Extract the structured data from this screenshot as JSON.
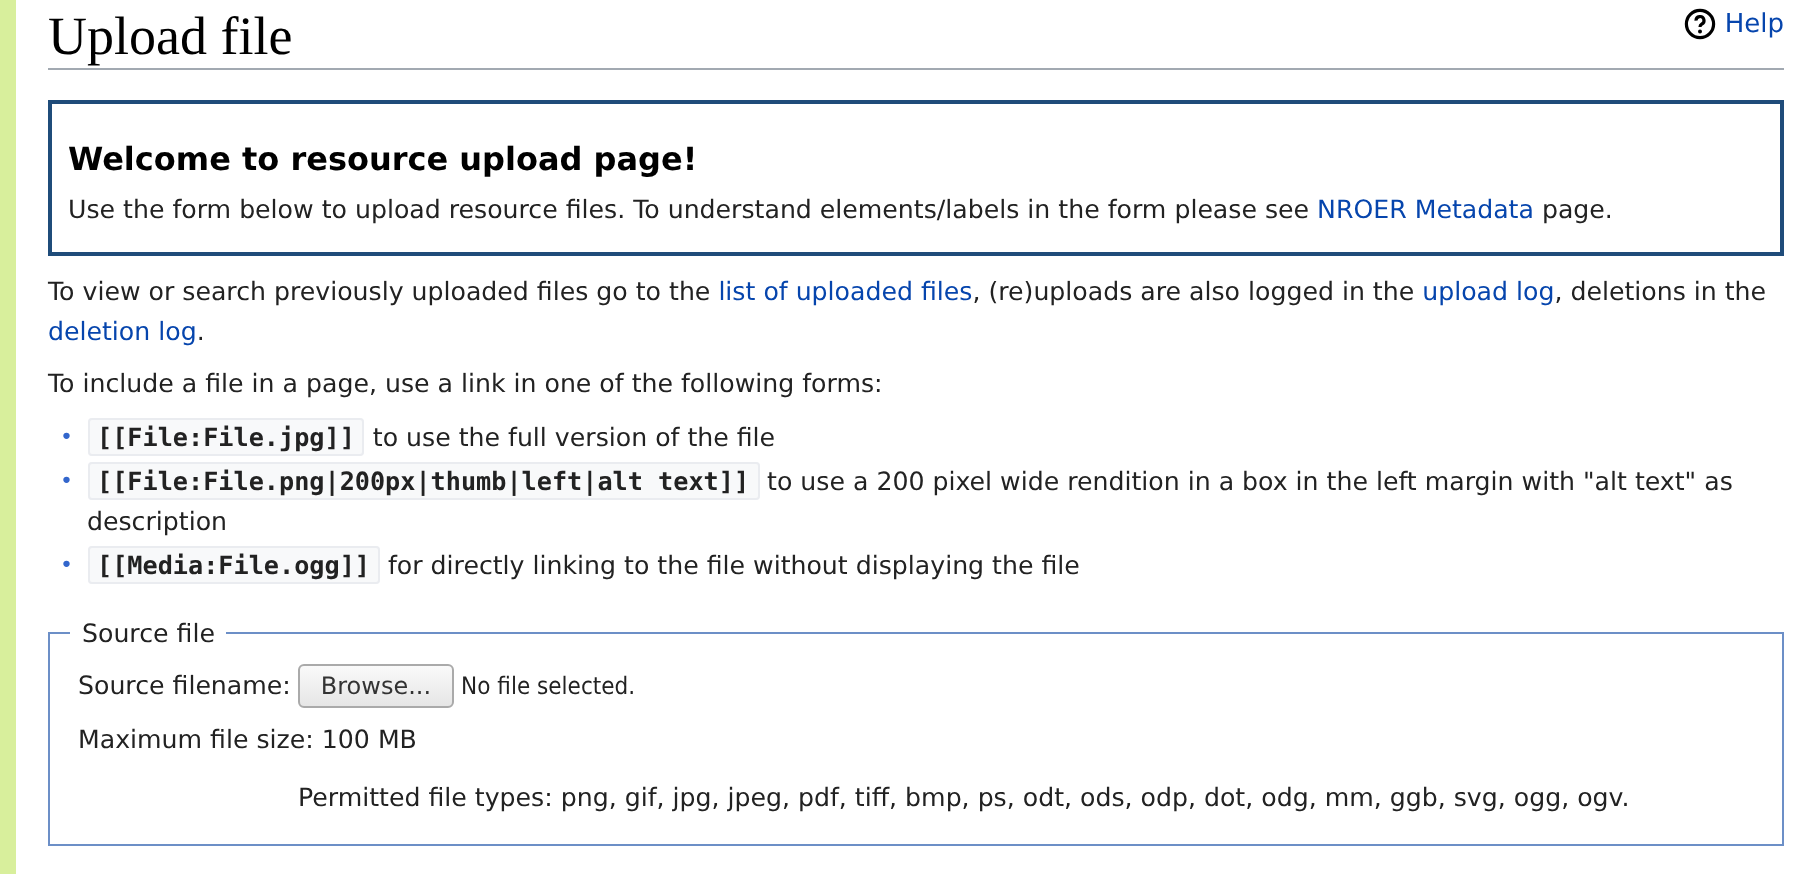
{
  "title": "Upload file",
  "help_link": "Help",
  "notice": {
    "heading": "Welcome to resource upload page!",
    "text": [
      {
        "text": "Use the form below to upload resource files. To understand elements/labels in the form please see "
      },
      {
        "link": "NROER Metadata"
      },
      {
        "text": " page."
      }
    ]
  },
  "paragraphs": [
    [
      {
        "text": "To view or search previously uploaded files go to the "
      },
      {
        "link": "list of uploaded files"
      },
      {
        "text": ", (re)uploads are also logged in the "
      },
      {
        "link": "upload log"
      },
      {
        "text": ", deletions in the "
      },
      {
        "link": "deletion log"
      },
      {
        "text": "."
      }
    ],
    [
      {
        "text": "To include a file in a page, use a link in one of the following forms:"
      }
    ]
  ],
  "forms": [
    {
      "bullet": "•",
      "code": "[[File:File.jpg]]",
      "text": "to use the full version of the file"
    },
    {
      "bullet": "•",
      "code": "[[File:File.png|200px|thumb|left|alt text]]",
      "text": "to use a 200 pixel wide rendition in a box in the left margin with \"alt text\" as description"
    },
    {
      "bullet": "•",
      "code": "[[Media:File.ogg]]",
      "text": "for directly linking to the file without displaying the file"
    }
  ],
  "source_file": {
    "legend": "Source file",
    "filename_label": "Source filename:",
    "browse_button": "Browse...",
    "file_status": "No file selected.",
    "max_size": "Maximum file size: 100 MB",
    "permitted": "Permitted file types: png, gif, jpg, jpeg, pdf, tiff, bmp, ps, odt, ods, odp, dot, odg, mm, ggb, svg, ogg, ogv."
  }
}
